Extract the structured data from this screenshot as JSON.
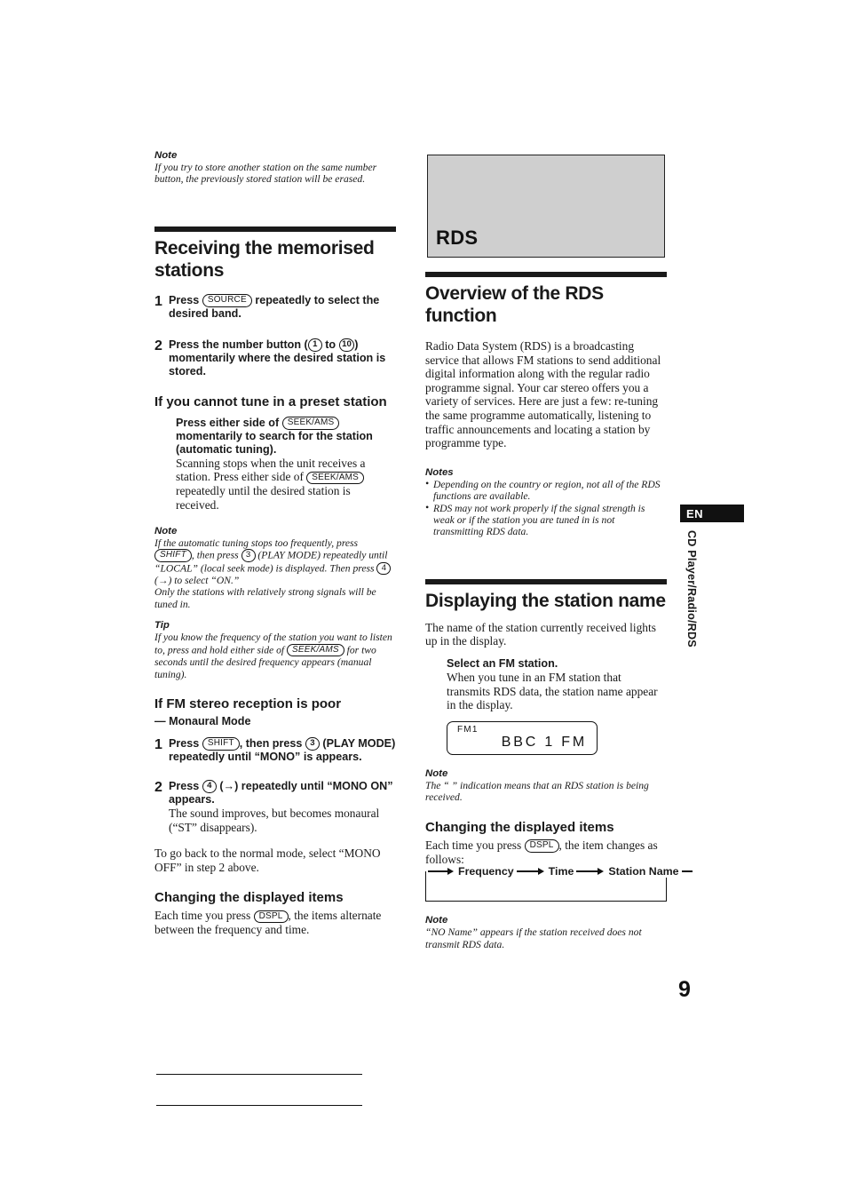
{
  "page": {
    "number": "9",
    "side_tab": {
      "language_code": "EN",
      "chapter_label": "CD Player/Radio/RDS"
    }
  },
  "left_column": {
    "top_note": {
      "label": "Note",
      "text": "If you try to store another station on the same number button, the previously stored station will be erased."
    },
    "section": {
      "title": "Receiving the memorised stations",
      "steps": [
        {
          "num": "1",
          "lead_before": "Press",
          "button": "SOURCE",
          "lead_after": "repeatedly to select the desired band."
        },
        {
          "num": "2",
          "lead_before": "Press the number button (",
          "button_from": "1",
          "lead_middle": "to",
          "button_to": "10",
          "lead_after": ") momentarily where the desired station is stored."
        }
      ]
    },
    "preset_fail": {
      "heading": "If you cannot tune in a preset station",
      "bold_before": "Press either side of",
      "bold_button": "SEEK/AMS",
      "bold_after": "momentarily to search for the station (automatic tuning).",
      "body_before": "Scanning stops when the unit receives a station. Press either side of",
      "body_button": "SEEK/AMS",
      "body_after": "repeatedly until the desired station is received."
    },
    "note_auto_tuning": {
      "label": "Note",
      "part1": "If the automatic tuning stops too frequently, press",
      "btn1": "SHIFT",
      "part2": ", then press",
      "btn2": "3",
      "part3": "(PLAY MODE) repeatedly until “LOCAL” (local seek mode) is displayed. Then press",
      "btn3": "4",
      "part4": "(→) to select “ON.”",
      "part5": "Only the stations with relatively strong signals will be tuned in."
    },
    "tip_frequency": {
      "label": "Tip",
      "part1": "If you know the frequency of the station you want to listen to, press and hold either side of",
      "btn1": "SEEK/AMS",
      "part2": "for two seconds until the desired frequency appears (manual tuning)."
    },
    "fm_stereo": {
      "heading": "If FM stereo reception is poor",
      "subheading": "— Monaural Mode",
      "steps": [
        {
          "num": "1",
          "lead_before": "Press",
          "btn1": "SHIFT",
          "lead_middle": ", then press",
          "btn2": "3",
          "lead_after": "(PLAY MODE) repeatedly until “MONO” is appears."
        },
        {
          "num": "2",
          "lead_before": "Press",
          "btn1": "4",
          "lead_after": "(→) repeatedly until “MONO ON” appears.",
          "extra": "The sound improves, but becomes monaural (“ST” disappears)."
        }
      ],
      "closing": "To go back to the normal mode, select “MONO OFF” in step 2 above."
    },
    "changing_items": {
      "heading": "Changing the displayed items",
      "text_before": "Each time you press",
      "button": "DSPL",
      "text_after": ", the items alternate between the frequency and time."
    }
  },
  "right_column": {
    "chapter_banner": {
      "title": "RDS"
    },
    "overview": {
      "title": "Overview of the RDS function",
      "body": "Radio Data System (RDS) is a broadcasting service that allows FM stations to send additional digital information along with the regular radio programme signal. Your car stereo offers you a variety of services. Here are just a few: re-tuning the same programme automatically, listening to traffic announcements and locating a station by programme type.",
      "notes_label": "Notes",
      "notes": [
        "Depending on the country or region, not all of the RDS functions are available.",
        "RDS may not work properly if the signal strength is weak or if the station you are tuned in is not transmitting RDS data."
      ]
    },
    "displaying_station": {
      "title": "Displaying the station name",
      "intro": "The name of the station currently received lights up in the display.",
      "step_bold": "Select an FM station.",
      "step_body": "When you tune in an FM station that transmits RDS data, the station name appear in the display.",
      "lcd": {
        "preset": "FM1",
        "station_name": "BBC  1  FM"
      },
      "note": {
        "label": "Note",
        "text": "The “   ” indication means that an RDS station is being received."
      }
    },
    "changing_items": {
      "heading": "Changing the displayed items",
      "text_before": "Each time you press",
      "button": "DSPL",
      "text_after": ", the item changes as follows:",
      "cycle": [
        "Frequency",
        "Time",
        "Station Name"
      ],
      "note": {
        "label": "Note",
        "text": "“NO Name” appears if the station received does not transmit RDS data."
      }
    }
  }
}
